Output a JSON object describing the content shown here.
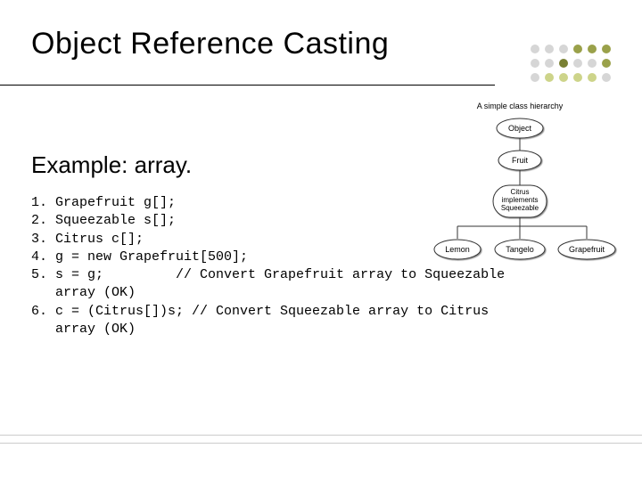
{
  "title": "Object Reference Casting",
  "subtitle": "Example: array.",
  "code": "1. Grapefruit g[];\n2. Squeezable s[];\n3. Citrus c[];\n4. g = new Grapefruit[500];\n5. s = g;         // Convert Grapefruit array to Squeezable\n   array (OK)\n6. c = (Citrus[])s; // Convert Squeezable array to Citrus\n   array (OK)",
  "diagram": {
    "caption": "A simple class hierarchy",
    "nodes": {
      "object": "Object",
      "fruit": "Fruit",
      "citrus_l1": "Citrus",
      "citrus_l2": "implements",
      "citrus_l3": "Squeezable",
      "lemon": "Lemon",
      "tangelo": "Tangelo",
      "grapefruit": "Grapefruit"
    }
  }
}
